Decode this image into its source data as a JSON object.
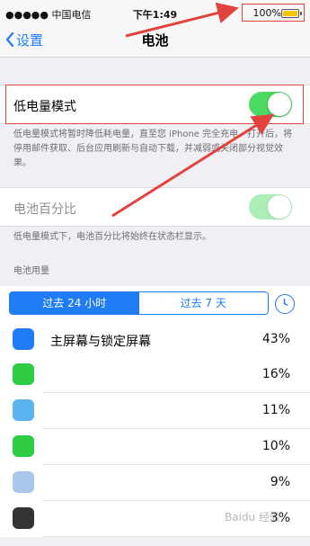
{
  "status_bar": {
    "carrier": "●●●●● 中国电信",
    "time": "下午1:49",
    "battery_percent": "100%"
  },
  "nav": {
    "back_label": "设置",
    "title": "电池"
  },
  "low_power": {
    "label": "低电量模式",
    "enabled": true,
    "footnote": "低电量模式将暂时降低耗电量，直至您 iPhone 完全充电。打开后，将停用邮件获取、后台应用刷新与自动下载，并减弱或关闭部分视觉效果。"
  },
  "battery_percentage": {
    "label": "电池百分比",
    "enabled": true,
    "disabled_state": true,
    "footnote": "低电量模式下，电池百分比将始终在状态栏显示。"
  },
  "usage": {
    "section_header": "电池用量",
    "tabs": [
      {
        "label": "过去 24 小时",
        "active": true
      },
      {
        "label": "过去 7 天",
        "active": false
      }
    ],
    "apps": [
      {
        "name": "主屏幕与锁定屏幕",
        "percent": "43%",
        "icon_color": "#1f7cf5"
      },
      {
        "name": "",
        "percent": "16%",
        "icon_color": "#2ecc40"
      },
      {
        "name": "",
        "percent": "11%",
        "icon_color": "#5ab4f0"
      },
      {
        "name": "",
        "percent": "10%",
        "icon_color": "#2ecc40"
      },
      {
        "name": "",
        "percent": "9%",
        "icon_color": "#a9c7e8"
      },
      {
        "name": "",
        "percent": "3%",
        "icon_color": "#333333"
      }
    ]
  },
  "watermark": "Baidu 经验",
  "colors": {
    "accent": "#1f7cf5",
    "toggle_on": "#4cd964",
    "annotation_red": "#e2443d"
  }
}
